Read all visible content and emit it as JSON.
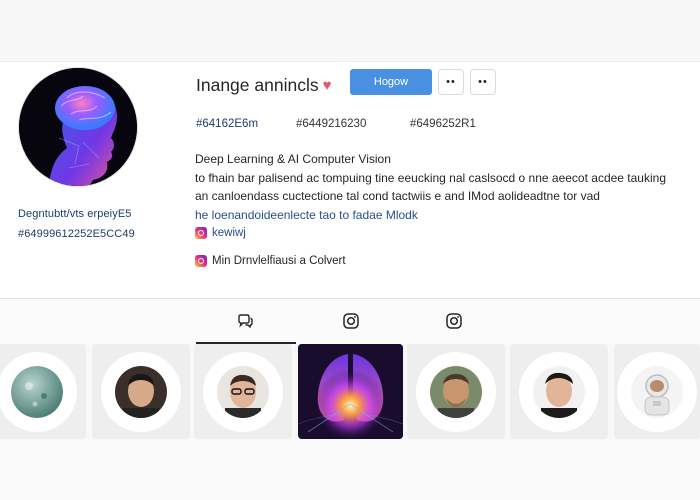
{
  "profile": {
    "username": "Inange annincls",
    "follow_label": "Hogow",
    "more_label_1": "••",
    "more_label_2": "••",
    "left_meta": [
      "Degntubtt/vts erpeiyE5",
      "#64999612252E5CC49"
    ],
    "stats": [
      "#64162E6m",
      "#6449216230",
      "#6496252R1"
    ],
    "bio": {
      "line1": "Deep Learning & AI Computer Vision",
      "line2": "to fhain bar palisend ac tompuing tine eeucking nal caslsocd o nne aeecot acdee tauking",
      "line3": "an canloendass cuctectione tal cond tactwiis e and IMod aolideadtne tor vad",
      "line4": "he loenandoideenlecte tao to fadae  Mlodk",
      "instagram_handle": "kewiwj",
      "mentions": "Min Drnvlelfiausi a  Colvert"
    }
  },
  "tabs": [
    {
      "icon": "chat-bubbles-icon",
      "active": true
    },
    {
      "icon": "instagram-icon",
      "active": false
    },
    {
      "icon": "instagram-icon",
      "active": false
    }
  ],
  "colors": {
    "accent": "#4a90e2",
    "link": "#2a4f8e",
    "heart": "#e25670"
  }
}
